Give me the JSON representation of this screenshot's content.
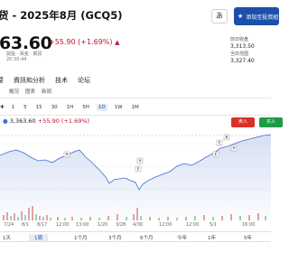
{
  "header": {
    "title": "货 - 2025年8月 (GCQ5)",
    "lang_label": "あ",
    "watch_label": "添加至投資組合"
  },
  "quote": {
    "price": "63.60",
    "change": "+55.90 (+1.69%)",
    "sub1": "開盤 · 黃金 · 期貨",
    "sub2": "20:30:44"
  },
  "side": {
    "label1": "前日收盘",
    "value1": "3,313.50",
    "label2": "当日范围",
    "value2": "3,327.40"
  },
  "tabs": [
    "要",
    "資訊和分析",
    "技术",
    "论坛"
  ],
  "subtabs": [
    "概况",
    "图表",
    "新闻"
  ],
  "ranges": [
    "1",
    "5",
    "15",
    "30",
    "1H",
    "5H",
    "1D",
    "1W",
    "1M"
  ],
  "ranges_active": "1D",
  "legend": {
    "value": "3,363.60",
    "change": "+55.90 (+1.69%)"
  },
  "actions": {
    "sell": "卖入",
    "buy": "买入"
  },
  "x_axis": [
    "7/24",
    "8/1",
    "8/17",
    "12:00",
    "13:00",
    "1/20",
    "3/28",
    "4/30",
    "12:00",
    "12:00",
    "5/1",
    "16:00"
  ],
  "periods": [
    "1天",
    "1周",
    "1个月",
    "3个月",
    "6个月",
    "今年",
    "1年",
    "5年"
  ],
  "periods_active": "1周",
  "markers": [
    "H",
    "H",
    "E",
    "E",
    "N",
    "H",
    "E"
  ],
  "colors": {
    "accent": "#1c4fa8",
    "up": "#c8102e",
    "sell": "#d9312a",
    "buy": "#1f9a45"
  }
}
